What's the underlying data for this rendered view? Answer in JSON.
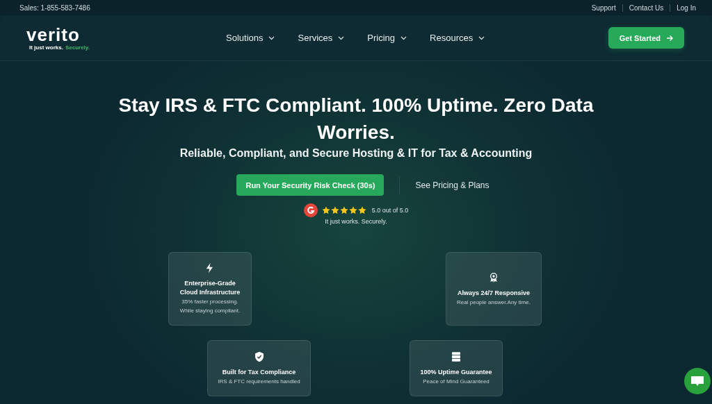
{
  "top_bar": {
    "sales": "Sales: 1-855-583-7486",
    "links": [
      "Support",
      "Contact Us",
      "Log In"
    ]
  },
  "logo": {
    "name": "verito",
    "tagline": "It just works.",
    "tagline_accent": "Securely."
  },
  "nav": [
    {
      "label": "Solutions"
    },
    {
      "label": "Services"
    },
    {
      "label": "Pricing"
    },
    {
      "label": "Resources"
    }
  ],
  "cta_button": "Get Started",
  "hero": {
    "title": "Stay IRS & FTC Compliant. 100% Uptime. Zero Data Worries.",
    "subtitle": "Reliable, Compliant, and Secure Hosting & IT for Tax & Accounting",
    "primary_button": "Run Your Security Risk Check (30s)",
    "secondary_link": "See Pricing & Plans",
    "rating": {
      "stars": 5,
      "score": "5.0 out of 5.0",
      "caption": "It just works. Securely."
    }
  },
  "features": [
    {
      "kind": "bolt",
      "title": "Enterprise-Grade Cloud Infrastructure",
      "lines": [
        "35% faster processing.",
        "While staying compliant."
      ]
    },
    {
      "kind": "award",
      "title": "Always 24/7 Responsive",
      "lines": [
        "Real people answer.Any time."
      ]
    },
    {
      "kind": "shield",
      "title": "Built for Tax Compliance",
      "lines": [
        "IRS & FTC requirements handled"
      ]
    },
    {
      "kind": "server",
      "title": "100% Uptime Guarantee",
      "lines": [
        "Peace of Mind Guaranteed"
      ]
    }
  ]
}
